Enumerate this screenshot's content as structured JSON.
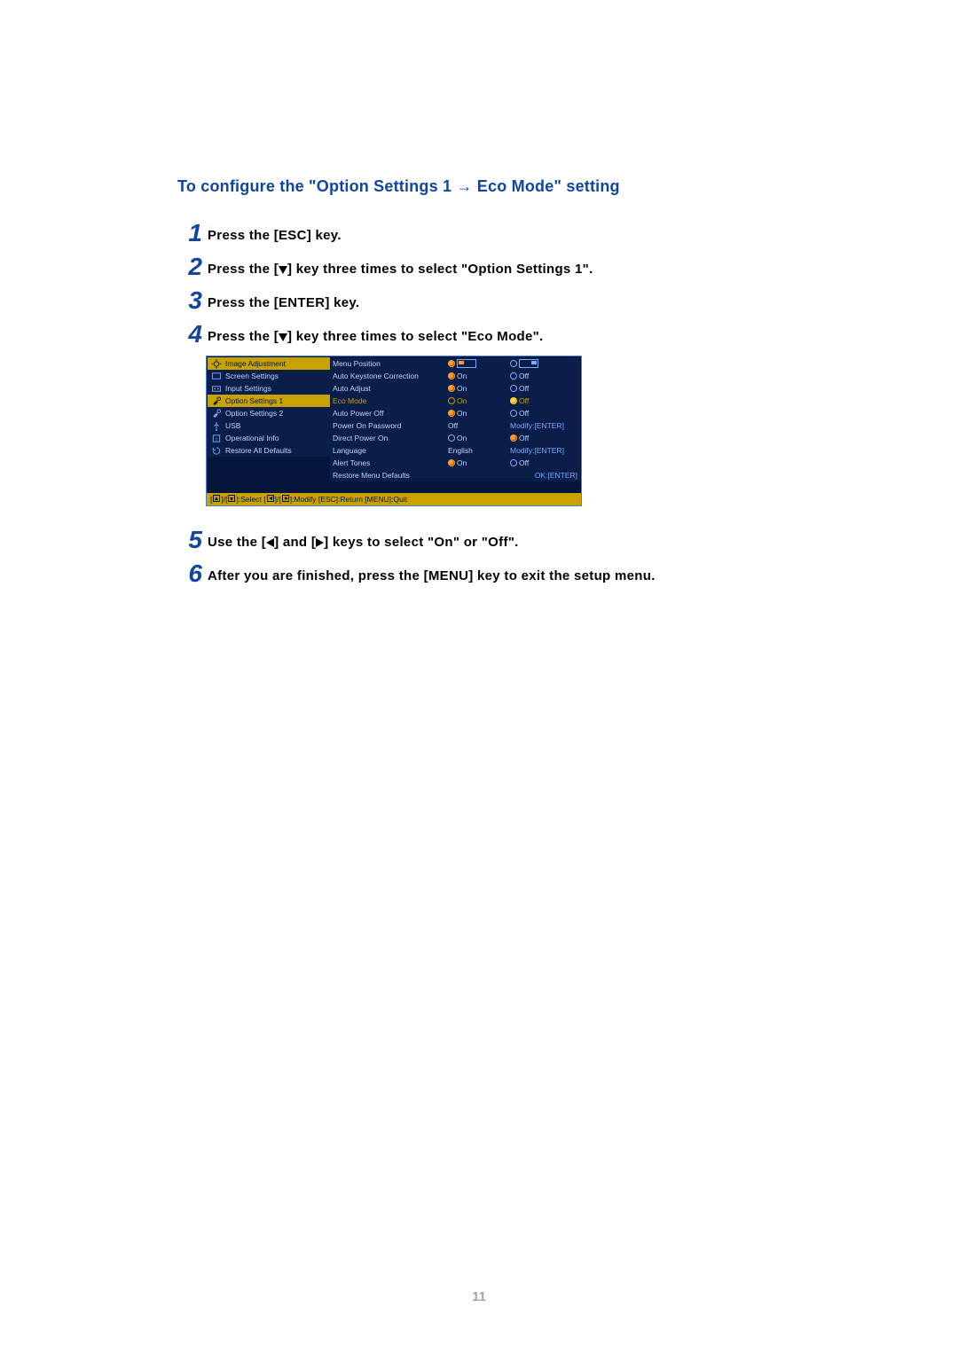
{
  "title_before": "To configure the \"Option Settings 1 ",
  "title_arrow": "→",
  "title_after": " Eco Mode\" setting",
  "steps": {
    "s1": "Press the [ESC] key.",
    "s2a": "Press the [",
    "s2b": "] key three times to select \"Option Settings 1\".",
    "s3": "Press the [ENTER] key.",
    "s4a": "Press the [",
    "s4b": "] key three times to select \"Eco Mode\".",
    "s5a": "Use the [",
    "s5b": "] and [",
    "s5c": "] keys to select \"On\" or \"Off\".",
    "s6": "After you are finished, press the [MENU] key to exit the setup menu."
  },
  "menu": {
    "left": [
      "Image Adjustment",
      "Screen Settings",
      "Input Settings",
      "Option Settings 1",
      "Option Settings 2",
      "USB",
      "Operational Info",
      "Restore All Defaults"
    ],
    "rows": [
      {
        "label": "Menu Position",
        "val": "",
        "val2": ""
      },
      {
        "label": "Auto Keystone Correction",
        "val_on": "On",
        "val_off": "Off",
        "on_sel": true
      },
      {
        "label": "Auto Adjust",
        "val_on": "On",
        "val_off": "Off",
        "on_sel": true
      },
      {
        "label": "Eco Mode",
        "val_on": "On",
        "val_off": "Off",
        "on_sel": false,
        "selected": true
      },
      {
        "label": "Auto Power Off",
        "val_on": "On",
        "val_off": "Off",
        "on_sel": true
      },
      {
        "label": "Power On Password",
        "val": "Off",
        "action": "Modify:[ENTER]"
      },
      {
        "label": "Direct Power On",
        "val_on": "On",
        "val_off": "Off",
        "on_sel": false
      },
      {
        "label": "Language",
        "val": "English",
        "action": "Modify:[ENTER]"
      },
      {
        "label": "Alert Tones",
        "val_on": "On",
        "val_off": "Off",
        "on_sel": true
      },
      {
        "label": "Restore Menu Defaults",
        "action": "OK:[ENTER]"
      }
    ],
    "footer": {
      "select": ":Select",
      "modify": ":Modify",
      "ret": "[ESC]:Return",
      "quit": "[MENU]:Quit"
    }
  },
  "page_number": "11"
}
